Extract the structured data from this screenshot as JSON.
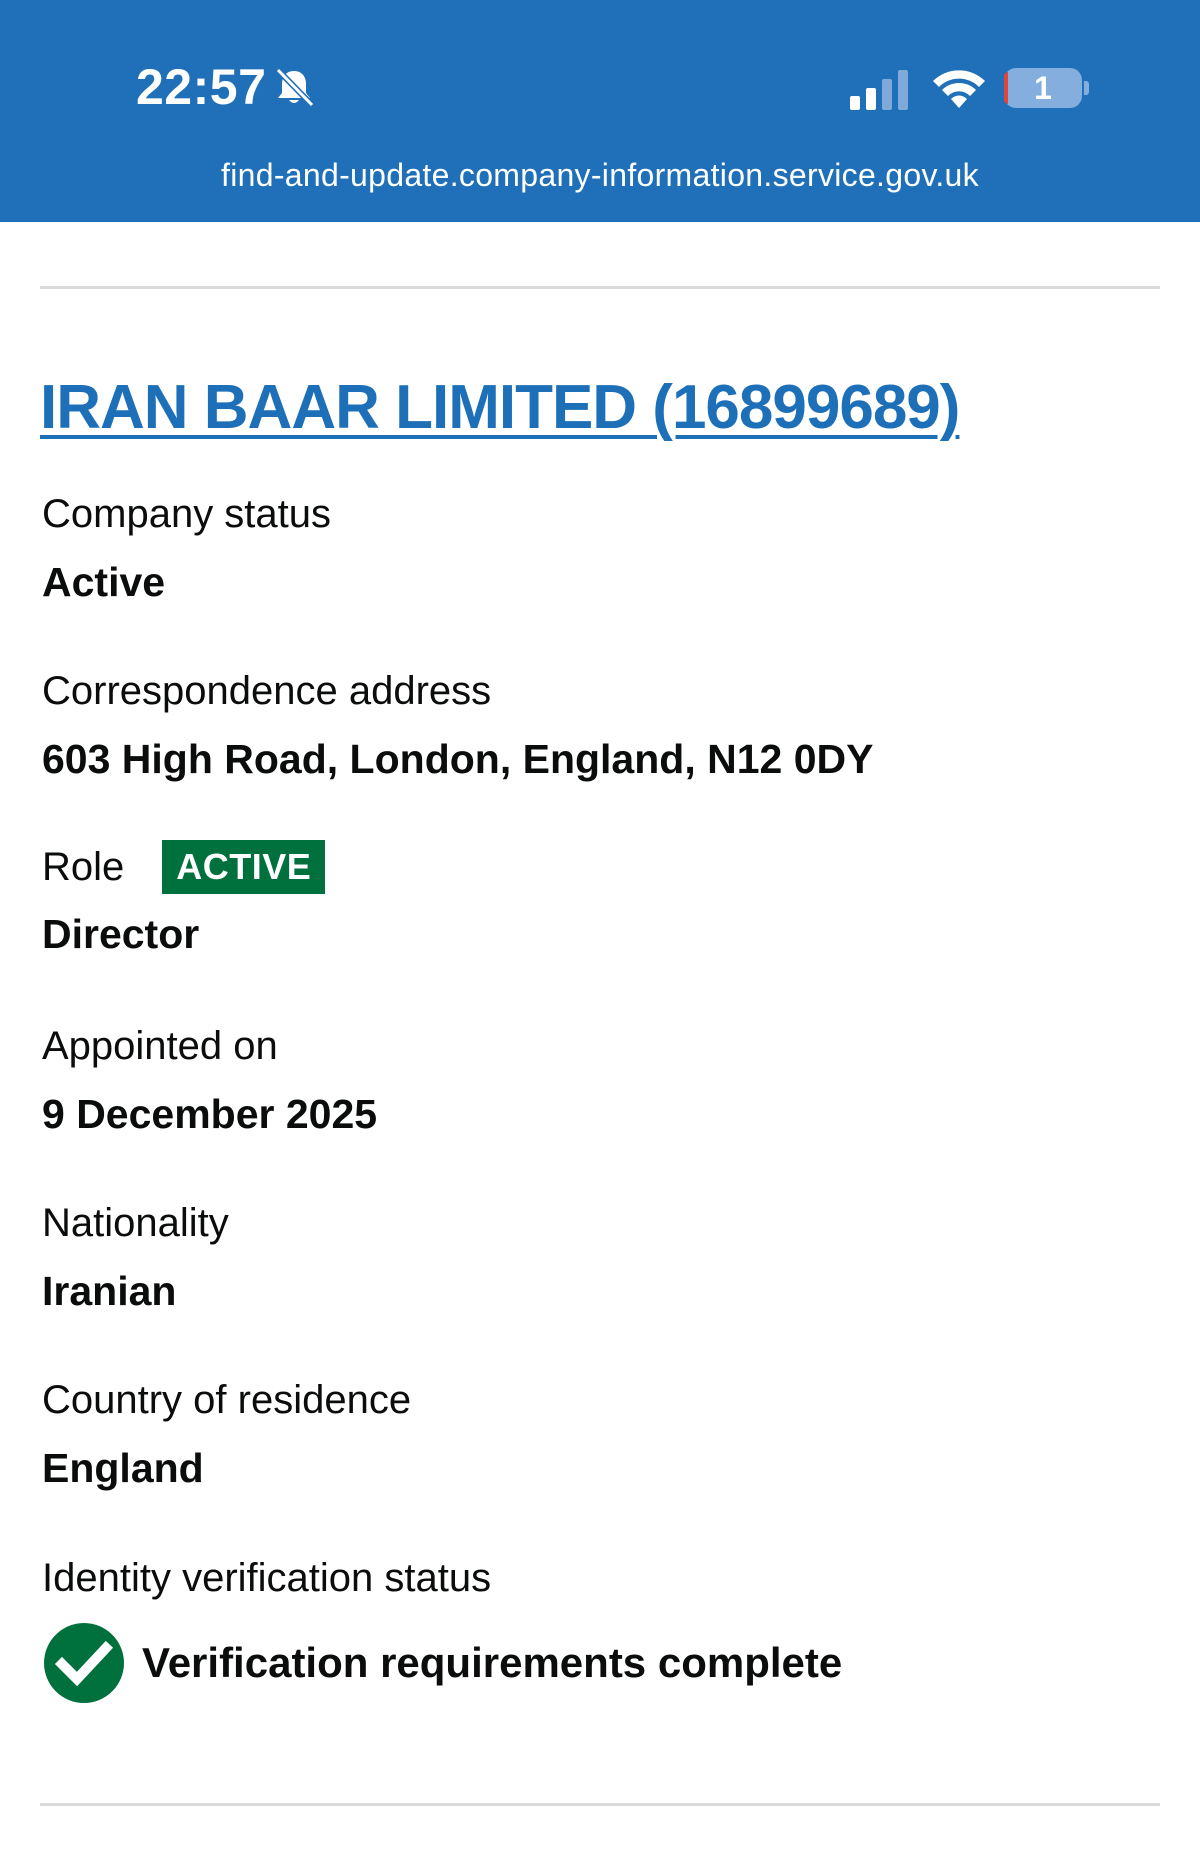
{
  "status_bar": {
    "time": "22:57",
    "battery_level": "1",
    "url": "find-and-update.company-information.service.gov.uk"
  },
  "company": {
    "title": "IRAN BAAR LIMITED (16899689)"
  },
  "fields": {
    "company_status": {
      "label": "Company status",
      "value": "Active"
    },
    "correspondence_address": {
      "label": "Correspondence address",
      "value": "603 High Road, London, England, N12 0DY"
    },
    "role": {
      "label": "Role",
      "tag": "ACTIVE",
      "value": "Director"
    },
    "appointed_on": {
      "label": "Appointed on",
      "value": "9 December 2025"
    },
    "nationality": {
      "label": "Nationality",
      "value": "Iranian"
    },
    "country_of_residence": {
      "label": "Country of residence",
      "value": "England"
    },
    "identity_verification": {
      "label": "Identity verification status",
      "value": "Verification requirements complete"
    }
  },
  "colors": {
    "header_blue": "#1f70b8",
    "link_blue": "#1d70b8",
    "tag_green": "#00703c",
    "text": "#0b0c0c"
  },
  "icons": {
    "mute": "bell-slash-icon",
    "signal": "cellular-signal-icon",
    "wifi": "wifi-icon",
    "battery": "battery-icon",
    "verified": "check-circle-icon"
  }
}
